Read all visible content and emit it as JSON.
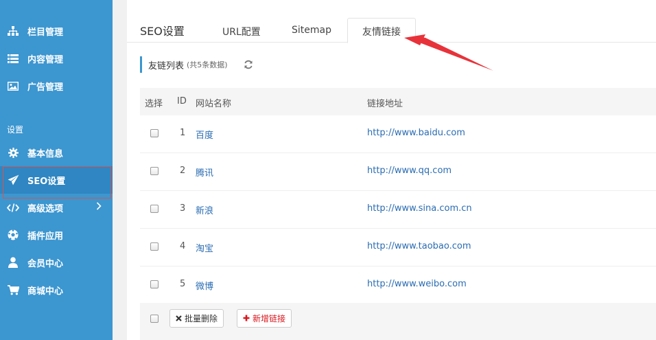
{
  "sidebar": {
    "items": [
      {
        "label": "栏目管理",
        "icon": "sitemap-icon"
      },
      {
        "label": "内容管理",
        "icon": "list-icon"
      },
      {
        "label": "广告管理",
        "icon": "image-icon"
      },
      {
        "label": "基本信息",
        "icon": "gear-icon"
      },
      {
        "label": "SEO设置",
        "icon": "paper-plane-icon"
      },
      {
        "label": "高级选项",
        "icon": "code-icon"
      },
      {
        "label": "插件应用",
        "icon": "football-icon"
      },
      {
        "label": "会员中心",
        "icon": "user-icon"
      },
      {
        "label": "商城中心",
        "icon": "cart-icon"
      }
    ],
    "section_label": "设置",
    "active_item": "SEO设置"
  },
  "header": {
    "page_title": "SEO设置",
    "tabs": [
      "URL配置",
      "Sitemap",
      "友情链接"
    ],
    "active_tab": "友情链接"
  },
  "list": {
    "title": "友链列表",
    "count": "(共5条数据)",
    "columns": [
      "选择",
      "ID",
      "网站名称",
      "链接地址"
    ],
    "rows": [
      {
        "id": "1",
        "name": "百度",
        "url": "http://www.baidu.com"
      },
      {
        "id": "2",
        "name": "腾讯",
        "url": "http://www.qq.com"
      },
      {
        "id": "3",
        "name": "新浪",
        "url": "http://www.sina.com.cn"
      },
      {
        "id": "4",
        "name": "淘宝",
        "url": "http://www.taobao.com"
      },
      {
        "id": "5",
        "name": "微博",
        "url": "http://www.weibo.com"
      }
    ]
  },
  "footer": {
    "delete_label": "批量删除",
    "add_label": "新增链接"
  },
  "colors": {
    "sidebar_bg": "#3c96d0",
    "link": "#2a6cb2",
    "add_button": "#d9181e",
    "annotation_arrow": "#e8323a"
  }
}
